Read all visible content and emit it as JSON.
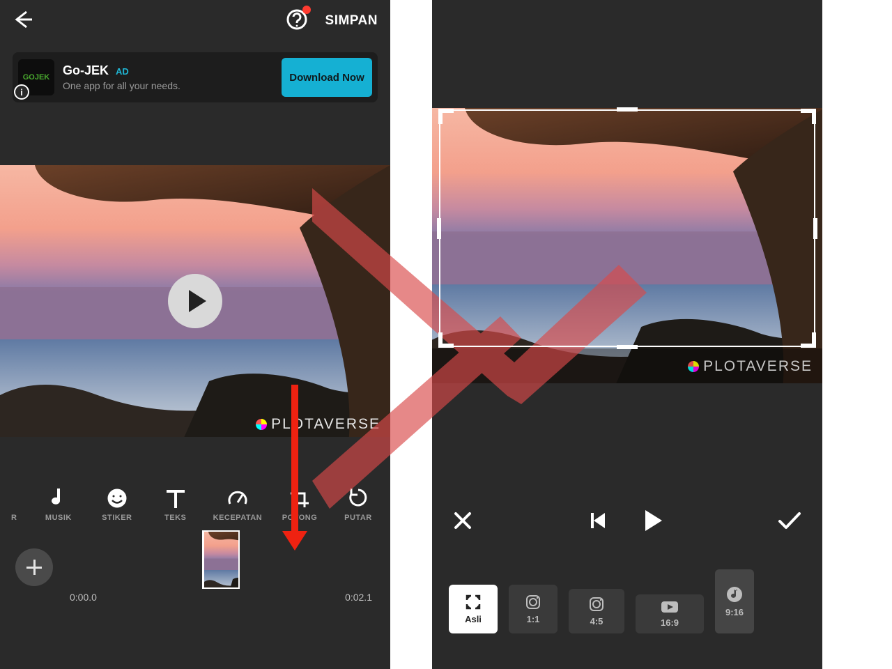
{
  "left": {
    "save_label": "SIMPAN",
    "ad": {
      "brand": "Go-JEK",
      "pill": "AD",
      "sub": "One app for all your needs.",
      "cta": "Download Now",
      "logo_text": "GOJEK"
    },
    "watermark": "PLOTAVERSE",
    "tools": [
      {
        "name": "filter-edge",
        "label": "R"
      },
      {
        "name": "music",
        "label": "MUSIK"
      },
      {
        "name": "sticker",
        "label": "STIKER"
      },
      {
        "name": "text",
        "label": "TEKS"
      },
      {
        "name": "speed",
        "label": "KECEPATAN"
      },
      {
        "name": "crop",
        "label": "POTONG"
      },
      {
        "name": "rotate",
        "label": "PUTAR"
      }
    ],
    "time_start": "0:00.0",
    "time_end": "0:02.1"
  },
  "right": {
    "watermark": "PLOTAVERSE",
    "ratios": [
      {
        "name": "original",
        "label": "Asli",
        "selected": true
      },
      {
        "name": "ig-square",
        "label": "1:1"
      },
      {
        "name": "ig-portrait",
        "label": "4:5"
      },
      {
        "name": "youtube",
        "label": "16:9"
      },
      {
        "name": "musically",
        "label": "9:16"
      }
    ]
  }
}
